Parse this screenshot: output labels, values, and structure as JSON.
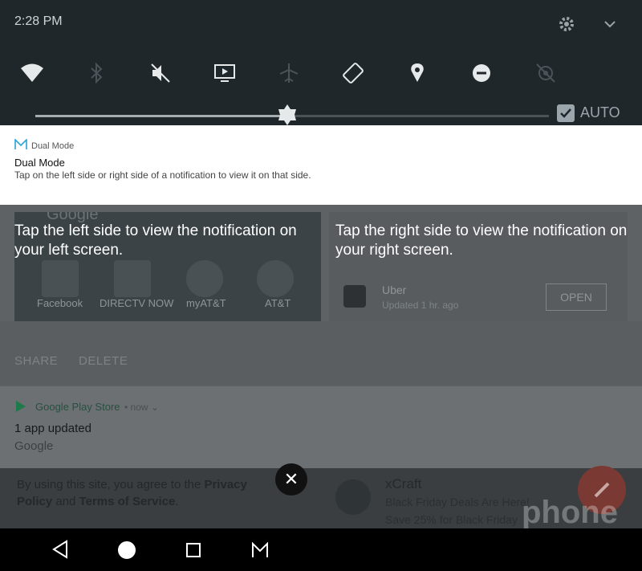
{
  "status_bar": {
    "time": "2:28 PM"
  },
  "quick_settings": {
    "tiles": [
      "wifi-icon",
      "bluetooth-icon",
      "mute-icon",
      "cast-icon",
      "airplane-icon",
      "rotate-icon",
      "location-icon",
      "do-not-disturb-icon",
      "hotspot-icon",
      "night-light-icon"
    ],
    "brightness_level": 0.49,
    "auto_label": "AUTO"
  },
  "dual_mode_card": {
    "app_name": "Dual Mode",
    "title": "Dual Mode",
    "text": "Tap on the left side or right side of a notification to view it on that side."
  },
  "left_preview": {
    "google": "Google",
    "apps": [
      "Facebook",
      "DIRECTV NOW",
      "myAT&T",
      "AT&T"
    ],
    "hint": "Tap the left side to view the notification on your left screen."
  },
  "right_preview": {
    "hint": "Tap the right side to view the notification on your right screen.",
    "uber_title": "Uber",
    "uber_sub": "Updated 1 hr. ago",
    "open_label": "OPEN"
  },
  "actions": {
    "share": "SHARE",
    "delete": "DELETE"
  },
  "play_store": {
    "app": "Google Play Store",
    "meta": "• now ⌄",
    "title": "1 app updated",
    "sub": "Google"
  },
  "web_strip": {
    "privacy_pre": "By using this site, you agree to the ",
    "privacy_link": "Privacy Policy",
    "and": " and ",
    "terms_link": "Terms of Service",
    "period": ".",
    "close": "✕",
    "xcraft_title": "xCraft",
    "xcraft_line1": "Black Friday Deals Are Here!",
    "xcraft_line2": "Save 25% for Black Friday"
  },
  "watermark": "phone scoop",
  "colors": {
    "accent_blue": "#2aa3d7",
    "play_green": "#1e7a4a",
    "check_bg": "#9aa6ac"
  }
}
